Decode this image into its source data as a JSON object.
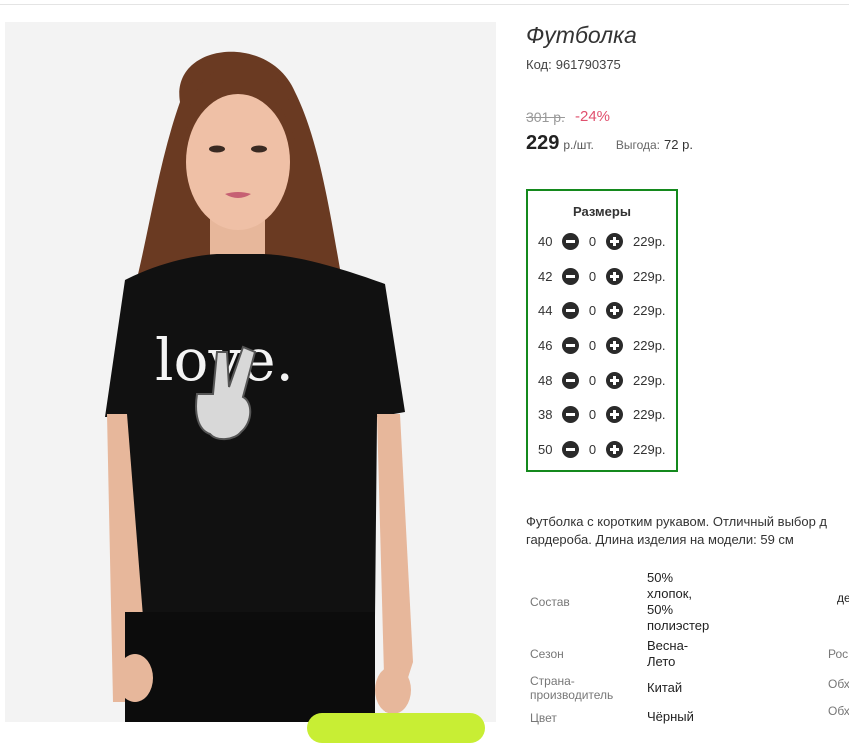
{
  "product": {
    "title": "Футболка",
    "code_label": "Код:",
    "code_value": "961790375",
    "old_price": "301 р.",
    "discount": "-24%",
    "price": "229",
    "price_unit": "р./шт.",
    "benefit_label": "Выгода:",
    "benefit_value": "72 р.",
    "photo_shirt_print": "love."
  },
  "sizes": {
    "title": "Размеры",
    "rows": [
      {
        "size": "40",
        "qty": "0",
        "price": "229р."
      },
      {
        "size": "42",
        "qty": "0",
        "price": "229р."
      },
      {
        "size": "44",
        "qty": "0",
        "price": "229р."
      },
      {
        "size": "46",
        "qty": "0",
        "price": "229р."
      },
      {
        "size": "48",
        "qty": "0",
        "price": "229р."
      },
      {
        "size": "38",
        "qty": "0",
        "price": "229р."
      },
      {
        "size": "50",
        "qty": "0",
        "price": "229р."
      }
    ]
  },
  "description": {
    "line1": "Футболка с коротким рукавом. Отличный выбор д",
    "line2": "гардероба. Длина изделия на модели: 59 см"
  },
  "properties": {
    "composition_label": "Состав",
    "composition_value_1": "50%",
    "composition_value_2": "хлопок,",
    "composition_value_3": "50%",
    "composition_value_4": "полиэстер",
    "season_label": "Сезон",
    "season_value_1": "Весна-",
    "season_value_2": "Лето",
    "country_label_1": "Страна-",
    "country_label_2": "производитель",
    "country_value": "Китай",
    "color_label": "Цвет",
    "color_value": "Чёрный",
    "extra_1": "де",
    "extra_2": "Рос",
    "extra_3": "Обх",
    "extra_4": "Обх"
  },
  "colors": {
    "accent_green": "#14891d",
    "discount_red": "#e0506e",
    "button_lime": "#c8ee34"
  }
}
